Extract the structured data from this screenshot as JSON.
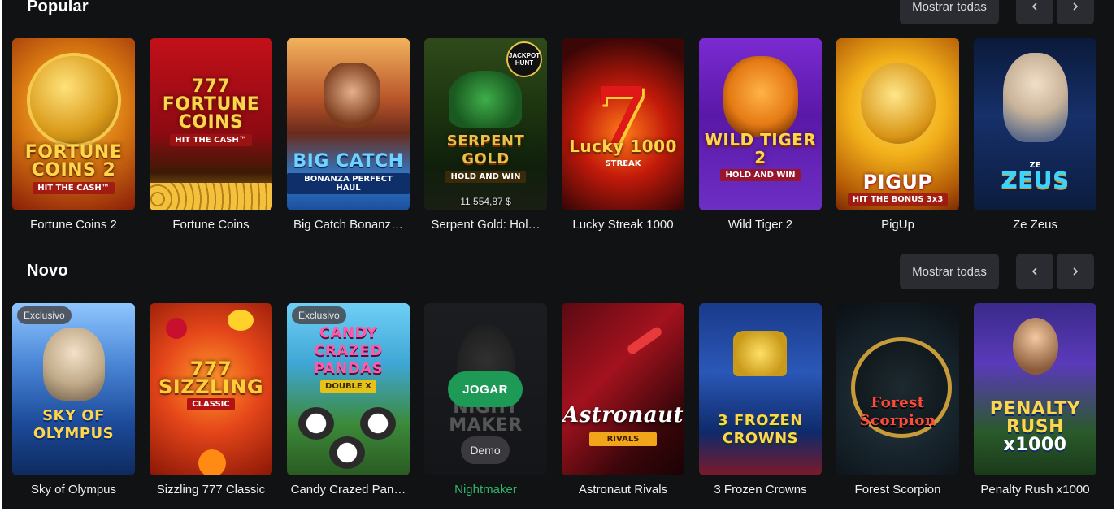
{
  "sections": [
    {
      "title": "Popular",
      "show_all_label": "Mostrar todas",
      "games": [
        {
          "name": "Fortune Coins 2",
          "art_title": "FORTUNE COINS 2",
          "art_sub": "HIT THE CASH™"
        },
        {
          "name": "Fortune Coins",
          "art_title": "777 FORTUNE COINS",
          "art_sub": "HIT THE CASH™"
        },
        {
          "name": "Big Catch Bonanz…",
          "art_title": "BIG CATCH",
          "art_sub": "BONANZA PERFECT HAUL"
        },
        {
          "name": "Serpent Gold: Hol…",
          "art_title": "SERPENT GOLD",
          "art_sub": "HOLD AND WIN",
          "jackpot_badge": "JACKPOT HUNT",
          "amount": "11 554,87 $"
        },
        {
          "name": "Lucky Streak 1000",
          "art_title": "Lucky 1000",
          "art_sub": "STREAK"
        },
        {
          "name": "Wild Tiger 2",
          "art_title": "WILD TIGER 2",
          "art_sub": "HOLD AND WIN"
        },
        {
          "name": "PigUp",
          "art_title": "PIGUP",
          "art_sub": "HIT THE BONUS 3x3"
        },
        {
          "name": "Ze Zeus",
          "art_title": "ZEUS",
          "art_sub": "ZE"
        }
      ]
    },
    {
      "title": "Novo",
      "show_all_label": "Mostrar todas",
      "games": [
        {
          "name": "Sky of Olympus",
          "art_title": "SKY OF OLYMPUS",
          "art_sub": "",
          "badge": "Exclusivo"
        },
        {
          "name": "Sizzling 777 Classic",
          "art_title": "777 SIZZLING",
          "art_sub": "CLASSIC"
        },
        {
          "name": "Candy Crazed Pan…",
          "art_title": "CANDY CRAZED PANDAS",
          "art_sub": "DOUBLE X",
          "badge": "Exclusivo"
        },
        {
          "name": "Nightmaker",
          "art_title": "NIGHT MAKER",
          "art_sub": "",
          "hover": true,
          "play_label": "JOGAR",
          "demo_label": "Demo"
        },
        {
          "name": "Astronaut Rivals",
          "art_title": "Astronaut",
          "art_sub": "RIVALS"
        },
        {
          "name": "3 Frozen Crowns",
          "art_title": "3 FROZEN CROWNS",
          "art_sub": ""
        },
        {
          "name": "Forest Scorpion",
          "art_title": "Forest Scorpion",
          "art_sub": ""
        },
        {
          "name": "Penalty Rush x1000",
          "art_title": "PENALTY RUSH",
          "art_sub": "x1000"
        }
      ]
    }
  ],
  "icons": {
    "prev": "chevron-left-icon",
    "next": "chevron-right-icon"
  },
  "colors": {
    "background": "#111214",
    "button": "#2a2c31",
    "play": "#1e9a57",
    "hover_name": "#2fb56a"
  }
}
